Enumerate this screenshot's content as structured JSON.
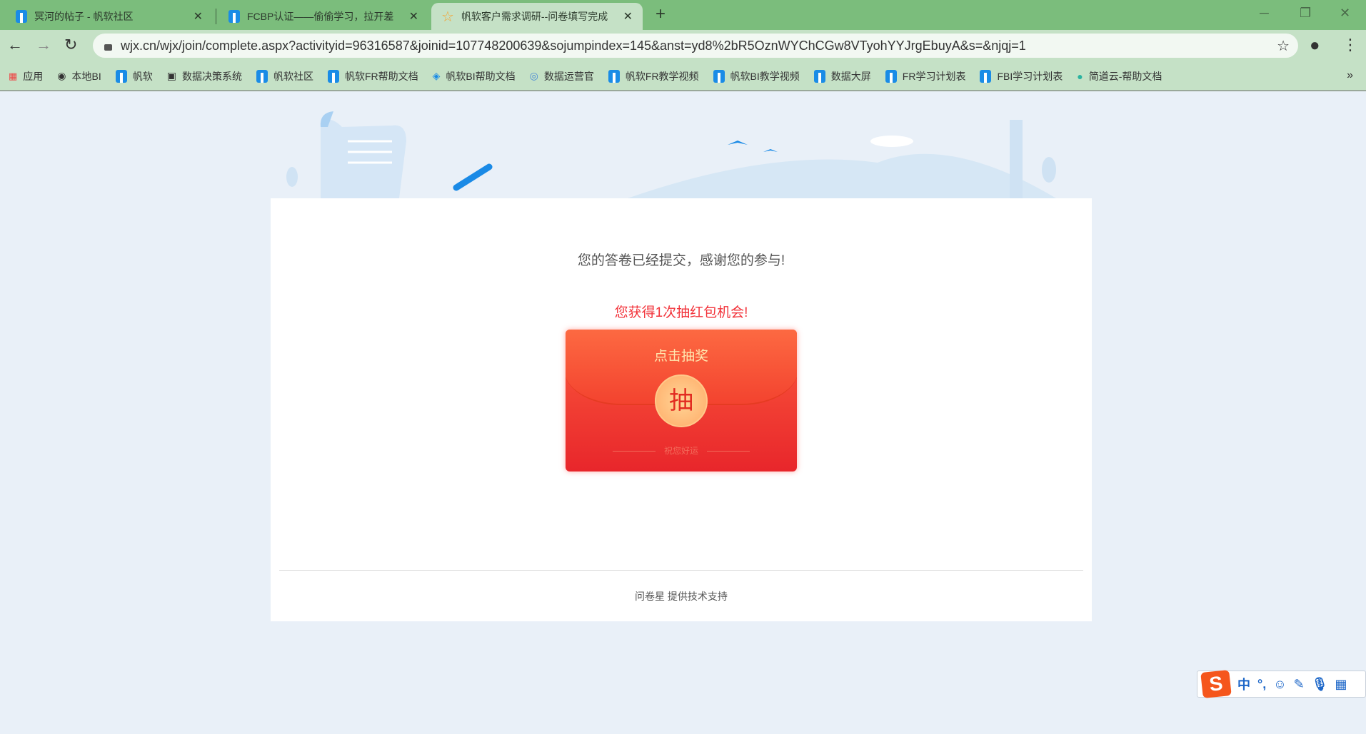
{
  "browser": {
    "tabs": [
      {
        "title": "冥河的帖子 - 帆软社区",
        "active": false,
        "icon": "fanruan-icon"
      },
      {
        "title": "FCBP认证——偷偷学习，拉开差",
        "active": false,
        "icon": "fanruan-icon"
      },
      {
        "title": "帆软客户需求调研--问卷填写完成",
        "active": true,
        "icon": "star-icon"
      }
    ],
    "new_tab": "+",
    "close": "✕",
    "url": "wjx.cn/wjx/join/complete.aspx?activityid=96316587&joinid=107748200639&sojumpindex=145&anst=yd8%2bR5OznWYChCGw8VTyohYYJrgEbuyA&s=&njqj=1",
    "bookmarks": [
      "应用",
      "本地BI",
      "帆软",
      "数据决策系统",
      "帆软社区",
      "帆软FR帮助文档",
      "帆软BI帮助文档",
      "数据运营官",
      "帆软FR教学视频",
      "帆软BI教学视频",
      "数据大屏",
      "FR学习计划表",
      "FBI学习计划表",
      "简道云-帮助文档"
    ],
    "bookmarks_more": "»"
  },
  "page": {
    "thanks": "您的答卷已经提交，感谢您的参与!",
    "prize_text": "您获得1次抽红包机会!",
    "envelope": {
      "title": "点击抽奖",
      "coin": "抽",
      "wish": "祝您好运"
    },
    "footer": "问卷星 提供技术支持"
  },
  "ime": {
    "logo": "S",
    "items": [
      "中",
      "°,",
      "☺",
      "✎",
      "🎙",
      "▦"
    ]
  },
  "colors": {
    "tabbar": "#7bbd7c",
    "toolbar": "#c5e1c6",
    "accent_red": "#f2333a",
    "envelope": "#e8262b"
  }
}
